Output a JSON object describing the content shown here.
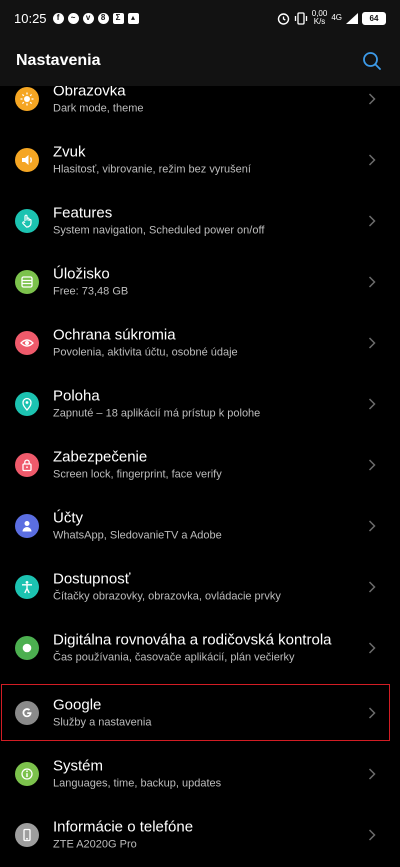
{
  "status_bar": {
    "time": "10:25",
    "net_speed_value": "0,00",
    "net_speed_unit": "K/s",
    "network": "4G",
    "battery": "64"
  },
  "header": {
    "title": "Nastavenia"
  },
  "settings": [
    {
      "title": "Obrazovka",
      "subtitle": "Dark mode, theme",
      "icon": "sun-icon",
      "color": "#f5a623"
    },
    {
      "title": "Zvuk",
      "subtitle": "Hlasitosť, vibrovanie, režim bez vyrušení",
      "icon": "speaker-icon",
      "color": "#f5a623"
    },
    {
      "title": "Features",
      "subtitle": "System navigation, Scheduled power on/off",
      "icon": "hand-icon",
      "color": "#1cc3b1"
    },
    {
      "title": "Úložisko",
      "subtitle": "Free: 73,48 GB",
      "icon": "storage-icon",
      "color": "#7cc24c"
    },
    {
      "title": "Ochrana súkromia",
      "subtitle": "Povolenia, aktivita účtu, osobné údaje",
      "icon": "privacy-eye-icon",
      "color": "#ef5a6b"
    },
    {
      "title": "Poloha",
      "subtitle": "Zapnuté – 18 aplikácií má prístup k polohe",
      "icon": "location-pin-icon",
      "color": "#1cc3b1"
    },
    {
      "title": "Zabezpečenie",
      "subtitle": "Screen lock, fingerprint, face verify",
      "icon": "lock-icon",
      "color": "#ef5a6b"
    },
    {
      "title": "Účty",
      "subtitle": "WhatsApp, SledovanieTV a Adobe",
      "icon": "person-icon",
      "color": "#5b6ee1"
    },
    {
      "title": "Dostupnosť",
      "subtitle": "Čítačky obrazovky, obrazovka, ovládacie prvky",
      "icon": "accessibility-icon",
      "color": "#1cc3b1"
    },
    {
      "title": "Digitálna rovnováha a rodičovská kontrola",
      "subtitle": "Čas používania, časovače aplikácií, plán večierky",
      "icon": "wellbeing-icon",
      "color": "#4caf50"
    },
    {
      "title": "Google",
      "subtitle": "Služby a nastavenia",
      "icon": "google-icon",
      "color": "#8a8a8a"
    },
    {
      "title": "Systém",
      "subtitle": "Languages, time, backup, updates",
      "icon": "system-info-icon",
      "color": "#7cc24c"
    },
    {
      "title": "Informácie o telefóne",
      "subtitle": "ZTE A2020G Pro",
      "icon": "phone-icon",
      "color": "#9e9e9e"
    }
  ]
}
